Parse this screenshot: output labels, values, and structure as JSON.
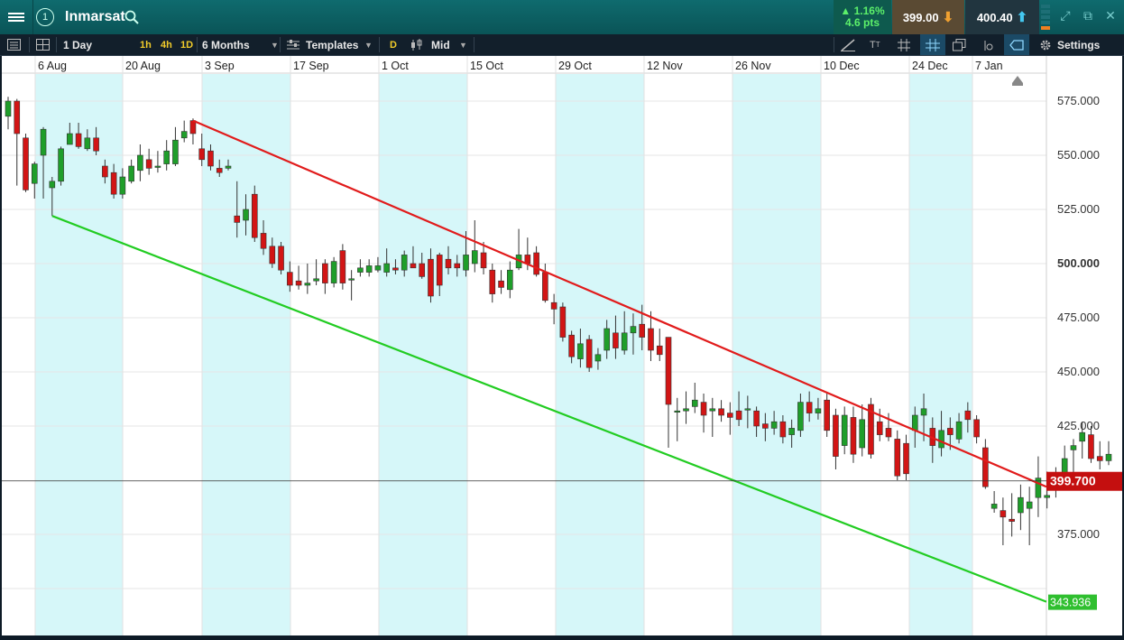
{
  "header": {
    "title": "Inmarsat",
    "badge": "1",
    "change_pct": "1.16%",
    "change_pts": "4.6 pts",
    "bid": "399.00",
    "ask": "400.40"
  },
  "toolbar": {
    "interval": "1 Day",
    "quick_intervals": [
      "1h",
      "4h",
      "1D"
    ],
    "range": "6 Months",
    "templates": "Templates",
    "d_label": "D",
    "price_mode": "Mid",
    "settings": "Settings"
  },
  "colors": {
    "accent_teal": "#0f6b6e",
    "up_candle": "#1f9e2a",
    "down_candle": "#d21515",
    "upper_line": "#e11b1b",
    "lower_line": "#22cc22",
    "highlight_band": "#d6f7f9"
  },
  "chart_data": {
    "type": "candlestick",
    "x_labels": [
      "6 Aug",
      "20 Aug",
      "3 Sep",
      "17 Sep",
      "1 Oct",
      "15 Oct",
      "29 Oct",
      "12 Nov",
      "26 Nov",
      "10 Dec",
      "24 Dec",
      "7 Jan"
    ],
    "y_ticks": [
      "575.000",
      "550.000",
      "525.000",
      "500.000",
      "475.000",
      "450.000",
      "425.000",
      "375.000"
    ],
    "ylim": [
      343,
      585
    ],
    "current_price_label": "399.700",
    "current_price": 399.7,
    "lower_line_label": "343.936",
    "upper_trendline": {
      "from": {
        "i": 21,
        "v": 566
      },
      "to": {
        "i": 136,
        "v": 397
      }
    },
    "lower_trendline": {
      "from": {
        "i": 5,
        "v": 522
      },
      "to": {
        "i": 136,
        "v": 343.9
      }
    },
    "candles": [
      [
        568,
        575,
        577,
        562
      ],
      [
        575,
        560,
        576,
        536
      ],
      [
        558,
        534,
        560,
        533
      ],
      [
        537,
        546,
        547,
        530
      ],
      [
        550,
        562,
        563,
        530
      ],
      [
        535,
        538,
        540,
        522
      ],
      [
        538,
        553,
        554,
        536
      ],
      [
        555,
        560,
        565,
        555
      ],
      [
        560,
        554,
        565,
        553
      ],
      [
        553,
        558,
        562,
        552
      ],
      [
        558,
        552,
        563,
        550
      ],
      [
        545,
        540,
        548,
        537
      ],
      [
        542,
        532,
        546,
        530
      ],
      [
        532,
        540,
        544,
        530
      ],
      [
        538,
        545,
        548,
        537
      ],
      [
        543,
        550,
        555,
        538
      ],
      [
        548,
        544,
        553,
        541
      ],
      [
        545,
        545,
        552,
        542
      ],
      [
        546,
        552,
        557,
        543
      ],
      [
        546,
        557,
        563,
        545
      ],
      [
        558,
        561,
        566,
        556
      ],
      [
        566,
        560,
        567,
        555
      ],
      [
        553,
        548,
        560,
        545
      ],
      [
        552,
        545,
        555,
        543
      ],
      [
        544,
        542,
        548,
        540
      ],
      [
        544,
        545,
        548,
        543
      ],
      [
        522,
        519,
        538,
        512
      ],
      [
        520,
        525,
        532,
        513
      ],
      [
        532,
        512,
        536,
        510
      ],
      [
        514,
        507,
        520,
        504
      ],
      [
        508,
        500,
        512,
        498
      ],
      [
        508,
        497,
        510,
        495
      ],
      [
        496,
        490,
        501,
        487
      ],
      [
        492,
        490,
        499,
        488
      ],
      [
        490,
        491,
        500,
        486
      ],
      [
        492,
        493,
        502,
        490
      ],
      [
        500,
        491,
        502,
        486
      ],
      [
        491,
        501,
        503,
        489
      ],
      [
        506,
        491,
        509,
        488
      ],
      [
        493,
        493,
        497,
        483
      ],
      [
        496,
        498,
        502,
        494
      ],
      [
        496,
        499,
        502,
        494
      ],
      [
        497,
        499,
        503,
        496
      ],
      [
        496,
        500,
        507,
        494
      ],
      [
        498,
        497,
        502,
        495
      ],
      [
        497,
        504,
        506,
        494
      ],
      [
        500,
        498,
        508,
        498
      ],
      [
        500,
        494,
        505,
        493
      ],
      [
        502,
        485,
        507,
        482
      ],
      [
        504,
        490,
        505,
        485
      ],
      [
        502,
        498,
        508,
        495
      ],
      [
        500,
        498,
        504,
        494
      ],
      [
        497,
        504,
        515,
        494
      ],
      [
        500,
        506,
        520,
        496
      ],
      [
        505,
        498,
        510,
        495
      ],
      [
        497,
        486,
        500,
        482
      ],
      [
        492,
        489,
        497,
        486
      ],
      [
        488,
        497,
        501,
        484
      ],
      [
        498,
        504,
        516,
        497
      ],
      [
        504,
        500,
        512,
        497
      ],
      [
        505,
        495,
        508,
        494
      ],
      [
        496,
        483,
        500,
        482
      ],
      [
        482,
        479,
        486,
        472
      ],
      [
        480,
        466,
        482,
        464
      ],
      [
        467,
        457,
        469,
        454
      ],
      [
        456,
        463,
        470,
        452
      ],
      [
        465,
        452,
        467,
        450
      ],
      [
        455,
        458,
        461,
        451
      ],
      [
        460,
        470,
        474,
        456
      ],
      [
        468,
        461,
        476,
        456
      ],
      [
        460,
        468,
        478,
        458
      ],
      [
        468,
        471,
        477,
        458
      ],
      [
        472,
        466,
        481,
        460
      ],
      [
        470,
        460,
        478,
        455
      ],
      [
        462,
        458,
        470,
        455
      ],
      [
        466,
        435,
        466,
        415
      ],
      [
        432,
        432,
        438,
        418
      ],
      [
        432,
        433,
        441,
        426
      ],
      [
        434,
        437,
        445,
        431
      ],
      [
        436,
        430,
        440,
        422
      ],
      [
        432,
        433,
        438,
        420
      ],
      [
        433,
        430,
        437,
        427
      ],
      [
        431,
        429,
        436,
        421
      ],
      [
        432,
        428,
        441,
        425
      ],
      [
        433,
        433,
        439,
        424
      ],
      [
        432,
        425,
        434,
        420
      ],
      [
        426,
        424,
        431,
        418
      ],
      [
        424,
        427,
        432,
        421
      ],
      [
        427,
        420,
        430,
        417
      ],
      [
        421,
        424,
        428,
        415
      ],
      [
        423,
        436,
        440,
        420
      ],
      [
        436,
        431,
        441,
        427
      ],
      [
        431,
        433,
        438,
        428
      ],
      [
        437,
        423,
        440,
        420
      ],
      [
        430,
        411,
        433,
        405
      ],
      [
        416,
        430,
        434,
        412
      ],
      [
        429,
        412,
        434,
        408
      ],
      [
        415,
        428,
        435,
        411
      ],
      [
        435,
        412,
        438,
        410
      ],
      [
        427,
        421,
        433,
        418
      ],
      [
        424,
        420,
        431,
        418
      ],
      [
        419,
        402,
        423,
        400
      ],
      [
        417,
        403,
        421,
        400
      ],
      [
        423,
        430,
        434,
        415
      ],
      [
        430,
        433,
        440,
        418
      ],
      [
        424,
        416,
        429,
        408
      ],
      [
        415,
        423,
        432,
        411
      ],
      [
        424,
        421,
        429,
        414
      ],
      [
        419,
        427,
        431,
        417
      ],
      [
        432,
        428,
        436,
        422
      ],
      [
        428,
        420,
        430,
        417
      ],
      [
        415,
        397,
        419,
        396
      ],
      [
        387,
        389,
        395,
        385
      ],
      [
        386,
        383,
        392,
        370
      ],
      [
        382,
        381,
        394,
        374
      ],
      [
        385,
        392,
        398,
        377
      ],
      [
        387,
        390,
        397,
        370
      ],
      [
        392,
        401,
        411,
        383
      ],
      [
        392,
        393,
        404,
        387
      ],
      [
        398,
        402,
        406,
        392
      ],
      [
        402,
        410,
        416,
        398
      ],
      [
        414,
        416,
        419,
        399
      ],
      [
        418,
        422,
        427,
        410
      ],
      [
        421,
        410,
        425,
        408
      ],
      [
        411,
        409,
        418,
        405
      ],
      [
        409,
        412,
        418,
        407
      ]
    ]
  }
}
